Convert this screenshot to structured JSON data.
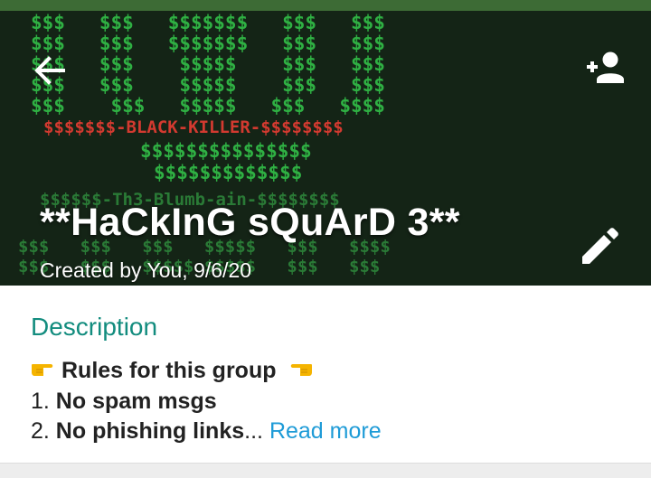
{
  "header": {
    "art_rows": [
      "$$$   $$$   $$$$$$$   $$$   $$$",
      "$$$   $$$   $$$$$$$   $$$   $$$",
      "$$$   $$$    $$$$$    $$$   $$$",
      "$$$   $$$    $$$$$    $$$   $$$",
      "$$$    $$$   $$$$$   $$$   $$$$"
    ],
    "art_banner": "$$$$$$$-BLACK-KILLER-$$$$$$$$",
    "art_rows_lower": [
      "$$$$$$$$$$$$$$$",
      "$$$$$$$$$$$$$",
      "$$$$$$-Th3-Blumb-ain-$$$$$$$$",
      "$$$   $$$   $$$   $$$$$   $$$   $$$$",
      "$$$   $$$   $$$$$ $$$$$   $$$   $$$"
    ],
    "title": "**HaCkInG sQuArD 3**",
    "created": "Created by You, 9/6/20"
  },
  "description": {
    "label": "Description",
    "line1": "Rules for this group",
    "line2_prefix": "1. ",
    "line2_bold": "No spam msgs",
    "line3_prefix": "2. ",
    "line3_bold": "No phishing links",
    "line3_ellipsis": "...",
    "read_more": "Read more"
  },
  "icons": {
    "back": "arrow-left-icon",
    "add_participant": "person-add-icon",
    "edit": "pencil-icon",
    "hand_right": "pointing-right-emoji",
    "hand_left": "pointing-left-emoji"
  },
  "colors": {
    "accent": "#128c7e",
    "link": "#1e9bd7",
    "art_green": "#2fb043",
    "art_red": "#d33a30"
  }
}
